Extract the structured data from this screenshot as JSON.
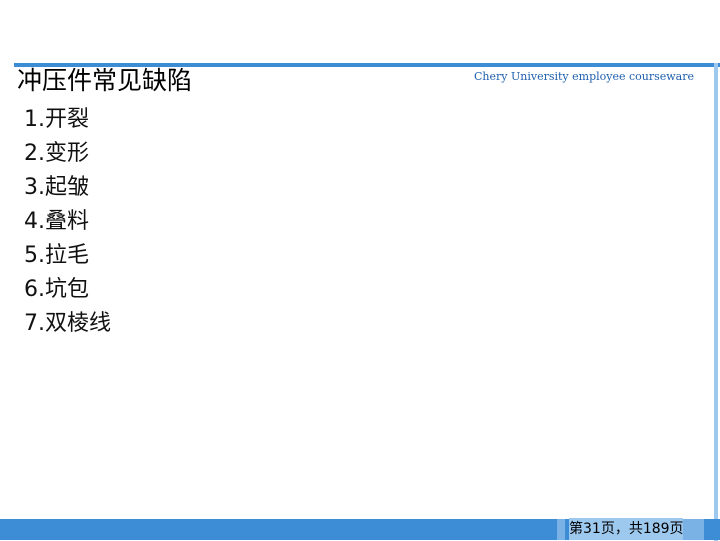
{
  "slide": {
    "title": "冲压件常见缺陷",
    "brand": "Chery University employee courseware",
    "items": [
      "1.开裂",
      "2.变形",
      "3.起皱",
      "4.叠料",
      "5.拉毛",
      "6.坑包",
      "7.双棱线"
    ],
    "page_indicator": "第31页，共189页"
  },
  "colors": {
    "accent_blue": "#3c8dd6",
    "light_blue": "#9ec9ef",
    "brand_text": "#1f5fae"
  }
}
